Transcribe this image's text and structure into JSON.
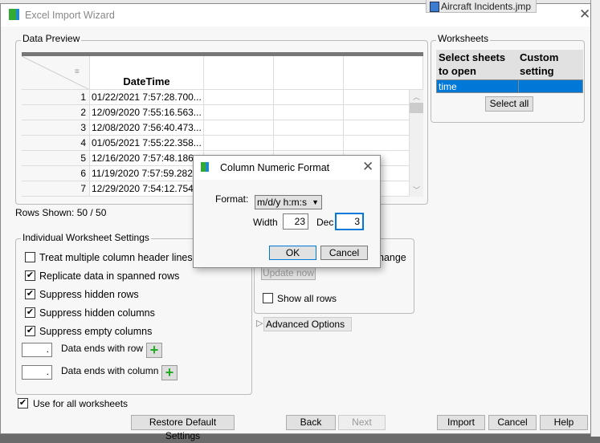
{
  "background": {
    "window_text": "Aircraft Incidents.jmp"
  },
  "window": {
    "title": "Excel Import Wizard",
    "close_icon": "close-icon"
  },
  "preview": {
    "legend": "Data Preview",
    "column_header": "DateTime",
    "rows": [
      {
        "n": "1",
        "v": "01/22/2021 7:57:28.700..."
      },
      {
        "n": "2",
        "v": "12/09/2020 7:55:16.563..."
      },
      {
        "n": "3",
        "v": "12/08/2020 7:56:40.473..."
      },
      {
        "n": "4",
        "v": "01/05/2021 7:55:22.358..."
      },
      {
        "n": "5",
        "v": "12/16/2020 7:57:48.186"
      },
      {
        "n": "6",
        "v": "11/19/2020 7:57:59.282"
      },
      {
        "n": "7",
        "v": "12/29/2020 7:54:12.754"
      }
    ],
    "rows_shown": "Rows Shown: 50 / 50"
  },
  "worksheets": {
    "legend": "Worksheets",
    "col1": "Select sheets to open",
    "col2": "Custom setting",
    "rows": [
      {
        "name": "time",
        "custom": ""
      }
    ],
    "select_all": "Select all"
  },
  "settings": {
    "legend": "Individual Worksheet Settings",
    "options": [
      {
        "label": "Treat multiple column header lines as",
        "checked": false
      },
      {
        "label": "Replicate data in spanned rows",
        "checked": true
      },
      {
        "label": "Suppress hidden rows",
        "checked": true
      },
      {
        "label": "Suppress hidden columns",
        "checked": true
      },
      {
        "label": "Suppress empty columns",
        "checked": true
      }
    ],
    "data_ends_row_label": "Data ends with row",
    "data_ends_row_value": ".",
    "data_ends_col_label": "Data ends with column",
    "data_ends_col_value": "."
  },
  "update": {
    "partial_label": "hange",
    "update_now": "Update now",
    "show_all_rows": "Show all rows"
  },
  "advanced": "Advanced Options",
  "use_all": {
    "label": "Use for all worksheets",
    "checked": true
  },
  "buttons": {
    "restore": "Restore Default Settings",
    "back": "Back",
    "next": "Next",
    "import": "Import",
    "cancel": "Cancel",
    "help": "Help"
  },
  "dialog": {
    "title": "Column Numeric Format",
    "format_label": "Format:",
    "format_value": "m/d/y h:m:s",
    "width_label": "Width",
    "width_value": "23",
    "dec_label": "Dec",
    "dec_value": "3",
    "ok": "OK",
    "cancel": "Cancel"
  },
  "colors": {
    "selection": "#0078d7",
    "focus": "#0078d7"
  }
}
